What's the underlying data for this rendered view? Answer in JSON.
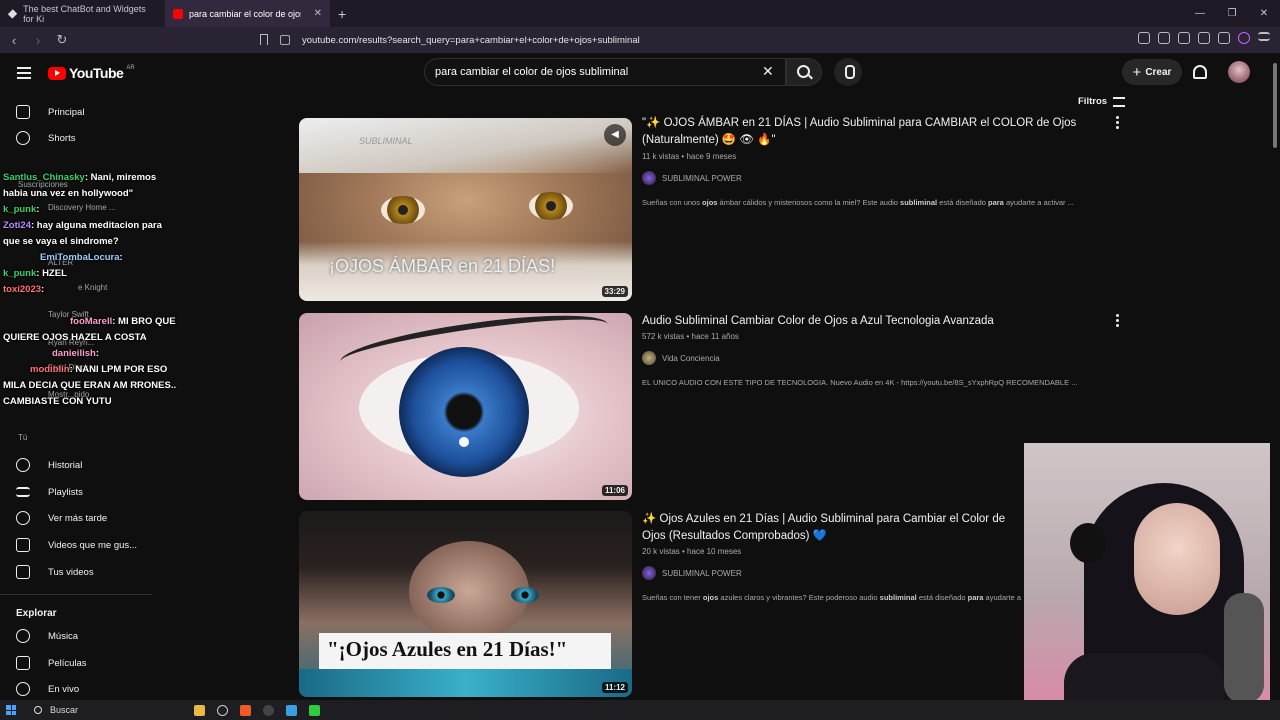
{
  "browser": {
    "tabs": [
      {
        "label": "The best ChatBot and Widgets for Ki"
      },
      {
        "label": "para cambiar el color de ojos su"
      }
    ],
    "url": "youtube.com/results?search_query=para+cambiar+el+color+de+ojos+subliminal"
  },
  "youtube": {
    "logo_text": "YouTube",
    "country": "AR",
    "search_value": "para cambiar el color de ojos subliminal",
    "create_label": "Crear",
    "filters_label": "Filtros"
  },
  "sidebar": {
    "top": [
      {
        "label": "Principal"
      },
      {
        "label": "Shorts"
      }
    ],
    "you_items": [
      {
        "label": "Historial"
      },
      {
        "label": "Playlists"
      },
      {
        "label": "Ver más tarde"
      },
      {
        "label": "Videos que me gus..."
      },
      {
        "label": "Tus videos"
      }
    ],
    "explore_title": "Explorar",
    "explore_items": [
      {
        "label": "Música"
      },
      {
        "label": "Películas"
      },
      {
        "label": "En vivo"
      }
    ],
    "ghost": {
      "subs": "Suscripciones",
      "disc": "Discovery Home ...",
      "alter": "ALTER",
      "knight": "e Knight",
      "taylor": "Taylor Swift",
      "ryan": "Ryan Reyn...",
      "farid": "Farid Dieck",
      "mostr": "Mostr...pido",
      "tu": "Tú"
    }
  },
  "chat": [
    {
      "user": "Santlus_Chinasky",
      "text": ": Nani, miremos"
    },
    {
      "user": "",
      "text": "habia una vez en hollywood\""
    },
    {
      "user": "k_punk",
      "text": ":"
    },
    {
      "user": "Zoti24",
      "text": ": hay alguna meditacion para"
    },
    {
      "user": "",
      "text": "que se vaya el sindrome?"
    },
    {
      "user": "EmiTombaLocura",
      "text": ":"
    },
    {
      "user": "k_punk",
      "text": ": HZEL"
    },
    {
      "user": "toxi2023",
      "text": ":"
    },
    {
      "user": "fooMarell",
      "text": ": MI BRO QUE"
    },
    {
      "user": "",
      "text": "QUIERE OJOS HAZEL A  COSTA"
    },
    {
      "user": "danieilish",
      "text": ":"
    },
    {
      "user": "modiblin",
      "text": ": NANI LPM POR ESO"
    },
    {
      "user": "",
      "text": "MILA DECIA QUE ERAN AM RRONES.."
    },
    {
      "user": "",
      "text": "CAMBIASTE CON YUTU"
    }
  ],
  "results": [
    {
      "title": "\"✨ OJOS ÁMBAR en 21 DÍAS | Audio Subliminal para CAMBIAR el COLOR de Ojos (Naturalmente) 🤩 👁 🔥\"",
      "meta": "11 k vistas • hace 9 meses",
      "channel": "SUBLIMINAL POWER",
      "desc_pre": "Sueñas con unos ",
      "desc_b1": "ojos",
      "desc_mid": " ámbar cálidos y misteriosos como la miel? Este audio ",
      "desc_b2": "subliminal",
      "desc_mid2": " está diseñado ",
      "desc_b3": "para",
      "desc_post": " ayudarte a activar ...",
      "thumb_text": "¡OJOS ÁMBAR en 21 DÍAS!",
      "thumb_watermark": "SUBLIMINAL",
      "duration": "33:29"
    },
    {
      "title": "Audio Subliminal Cambiar Color de Ojos a Azul Tecnologia Avanzada",
      "meta": "572 k vistas • hace 11 años",
      "channel": "Vida Conciencia",
      "desc": "EL UNICO AUDIO CON ESTE TIPO DE TECNOLOGIA. Nuevo Audio en 4K - https://youtu.be/8S_sYxphRpQ RECOMENDABLE ...",
      "duration": "11:06"
    },
    {
      "title": "✨ Ojos Azules en 21 Días | Audio Subliminal para Cambiar el Color de Ojos (Resultados Comprobados) 💙",
      "meta": "20 k vistas • hace 10 meses",
      "channel": "SUBLIMINAL POWER",
      "desc_pre": "Sueñas con tener ",
      "desc_b1": "ojos",
      "desc_mid": " azules claros y vibrantes? Este poderoso audio ",
      "desc_b2": "subliminal",
      "desc_mid2": " está diseñado ",
      "desc_b3": "para",
      "desc_post": " ayudarte a",
      "thumb_text": "\"¡Ojos Azules en 21 Días!\"",
      "duration": "11:12"
    }
  ],
  "taskbar": {
    "search_label": "Buscar"
  },
  "colors": {
    "accent": "#ff0000",
    "bg": "#0f0f0f",
    "chat_user": "#3bd06a"
  }
}
